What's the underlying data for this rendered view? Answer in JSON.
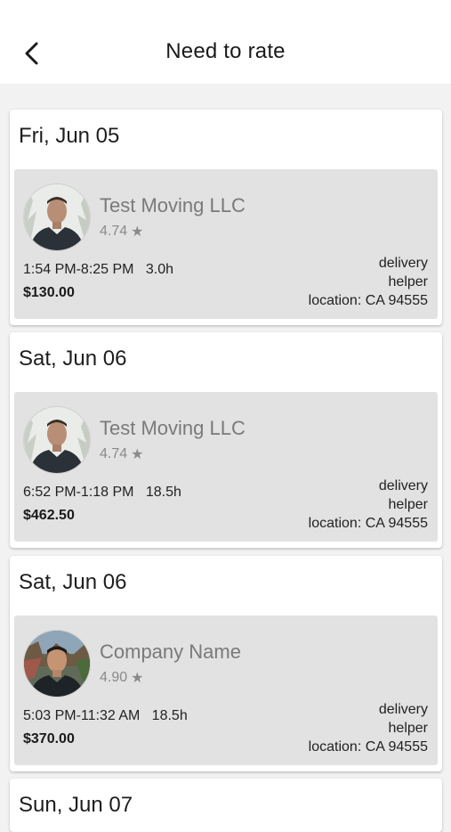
{
  "header": {
    "title": "Need to rate",
    "back_icon": "chevron-left-icon"
  },
  "cards": [
    {
      "date": "Fri, Jun 05",
      "company": "Test Moving LLC",
      "rating": "4.74",
      "time_range": "1:54 PM-8:25 PM",
      "duration": "3.0h",
      "price": "$130.00",
      "service_line1": "delivery",
      "service_line2": "helper",
      "location": "location: CA 94555",
      "avatar": "person-a"
    },
    {
      "date": "Sat, Jun 06",
      "company": "Test Moving LLC",
      "rating": "4.74",
      "time_range": "6:52 PM-1:18 PM",
      "duration": "18.5h",
      "price": "$462.50",
      "service_line1": "delivery",
      "service_line2": "helper",
      "location": "location: CA 94555",
      "avatar": "person-a"
    },
    {
      "date": "Sat, Jun 06",
      "company": "Company Name",
      "rating": "4.90",
      "time_range": "5:03 PM-11:32 AM",
      "duration": "18.5h",
      "price": "$370.00",
      "service_line1": "delivery",
      "service_line2": "helper",
      "location": "location: CA 94555",
      "avatar": "person-b"
    },
    {
      "date": "Sun, Jun 07"
    }
  ]
}
